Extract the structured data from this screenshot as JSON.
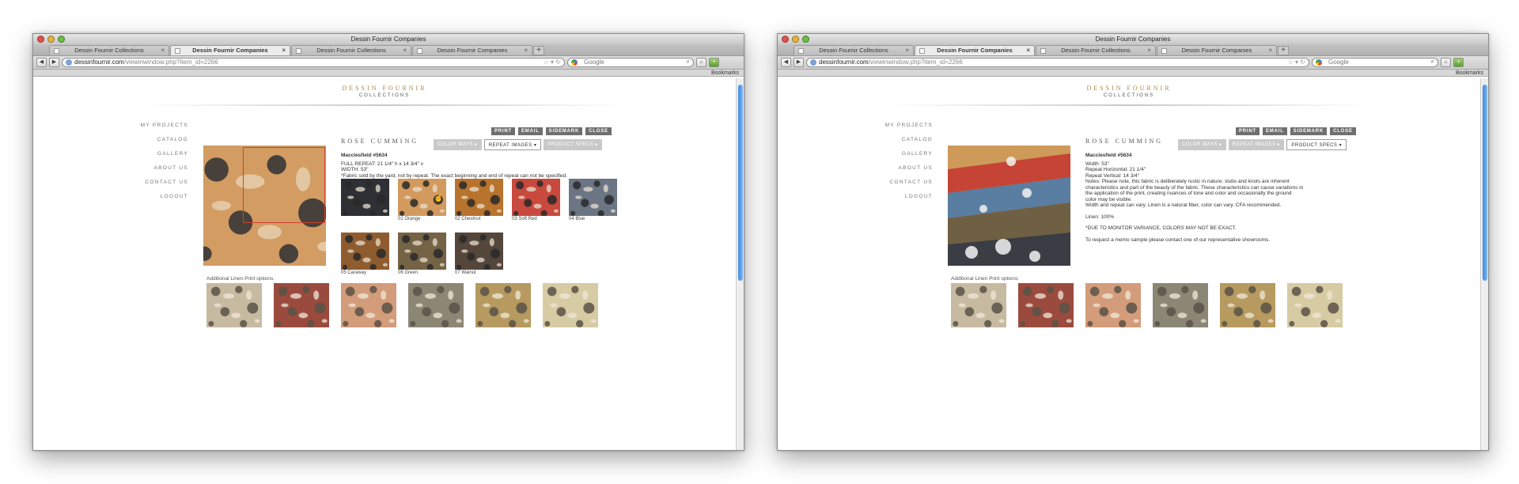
{
  "screens": [
    {
      "window_title": "Dessin Fournir Companies",
      "tabs": [
        {
          "label": "Dessin Fournir Collections",
          "active": false
        },
        {
          "label": "Dessin Fournir Companies",
          "active": true
        },
        {
          "label": "Dessin Fournir Collections",
          "active": false
        },
        {
          "label": "Dessin Fournir Companies",
          "active": false
        }
      ],
      "url_domain": "dessinfournir.com",
      "url_path": "/viewinwindow.php?item_id=2266",
      "search_placeholder": "Google",
      "bookmarks_label": "Bookmarks",
      "logo": {
        "line1": "DESSIN FOURNIR",
        "line2": "COLLECTIONS"
      },
      "nav": [
        "MY PROJECTS",
        "CATALOG",
        "GALLERY",
        "ABOUT US",
        "CONTACT US",
        "LOGOUT"
      ],
      "actions": [
        "PRINT",
        "EMAIL",
        "SIDEMARK",
        "CLOSE"
      ],
      "brand": "ROSE CUMMING",
      "product_tabs": [
        {
          "label": "COLOR WAYS",
          "active": false
        },
        {
          "label": "REPEAT IMAGES",
          "active": true
        },
        {
          "label": "PRODUCT SPECS",
          "active": false
        }
      ],
      "product_name": "Macclesfield #5634",
      "detail_lines": [
        "FULL REPEAT: 21 1/4\" h x 14 3/4\" v",
        "WIDTH: 53\"",
        "*Fabric sold by the yard, not by repeat. The exact beginning and end of repeat can not be specified."
      ],
      "swatches": [
        {
          "label": "",
          "color": "#2f3035"
        },
        {
          "label": "01 Orange",
          "color": "#d39a5e"
        },
        {
          "label": "02 Chestnut",
          "color": "#b8732d"
        },
        {
          "label": "03 Soft Red",
          "color": "#c8493d"
        },
        {
          "label": "04 Blue",
          "color": "#6b7584"
        },
        {
          "label": "05 Caraway",
          "color": "#8f5c30"
        },
        {
          "label": "06 Green",
          "color": "#756346"
        },
        {
          "label": "07 Walnut",
          "color": "#54463b"
        }
      ],
      "additional_label": "Additional Linen Print options:",
      "additional": [
        {
          "color": "#c6baa1"
        },
        {
          "color": "#9b4b3e"
        },
        {
          "color": "#d39c7a"
        },
        {
          "color": "#8c8675"
        },
        {
          "color": "#b69a5f"
        },
        {
          "color": "#d7cba4"
        }
      ]
    },
    {
      "window_title": "Dessin Fournir Companies",
      "tabs": [
        {
          "label": "Dessin Fournir Collections",
          "active": false
        },
        {
          "label": "Dessin Fournir Companies",
          "active": true
        },
        {
          "label": "Dessin Fournir Collections",
          "active": false
        },
        {
          "label": "Dessin Fournir Companies",
          "active": false
        }
      ],
      "url_domain": "dessinfournir.com",
      "url_path": "/viewinwindow.php?item_id=2266",
      "search_placeholder": "Google",
      "bookmarks_label": "Bookmarks",
      "logo": {
        "line1": "DESSIN FOURNIR",
        "line2": "COLLECTIONS"
      },
      "nav": [
        "MY PROJECTS",
        "CATALOG",
        "GALLERY",
        "ABOUT US",
        "CONTACT US",
        "LOGOUT"
      ],
      "actions": [
        "PRINT",
        "EMAIL",
        "SIDEMARK",
        "CLOSE"
      ],
      "brand": "ROSE CUMMING",
      "product_tabs": [
        {
          "label": "COLOR WAYS",
          "active": false
        },
        {
          "label": "REPEAT IMAGES",
          "active": false
        },
        {
          "label": "PRODUCT SPECS",
          "active": true
        }
      ],
      "product_name": "Macclesfield #5634",
      "detail_lines": [
        "Width: 53\"",
        "Repeat Horizontal: 21 1/4\"",
        "Repeat Vertical: 14 3/4\"",
        "Notes: Please note, this fabric is deliberately rustic in nature; slubs and knots are inherent",
        "characteristics and part of the beauty of the fabric. These characteristics can cause variations in",
        "the application of the print, creating nuances of tone and color and occasionally the ground",
        "color may be visible.",
        "Width and repeat can vary. Linen is a natural fiber, color can vary. CFA recommended.",
        "",
        "Linen: 100%",
        "",
        "*DUE TO MONITOR VARIANCE, COLORS MAY NOT BE EXACT.",
        "",
        "To request a memo sample please contact one of our representative showrooms."
      ],
      "additional_label": "Additional Linen Print options:",
      "additional": [
        {
          "color": "#c6baa1"
        },
        {
          "color": "#9b4b3e"
        },
        {
          "color": "#d39c7a"
        },
        {
          "color": "#8c8675"
        },
        {
          "color": "#b69a5f"
        },
        {
          "color": "#d7cba4"
        }
      ]
    }
  ]
}
